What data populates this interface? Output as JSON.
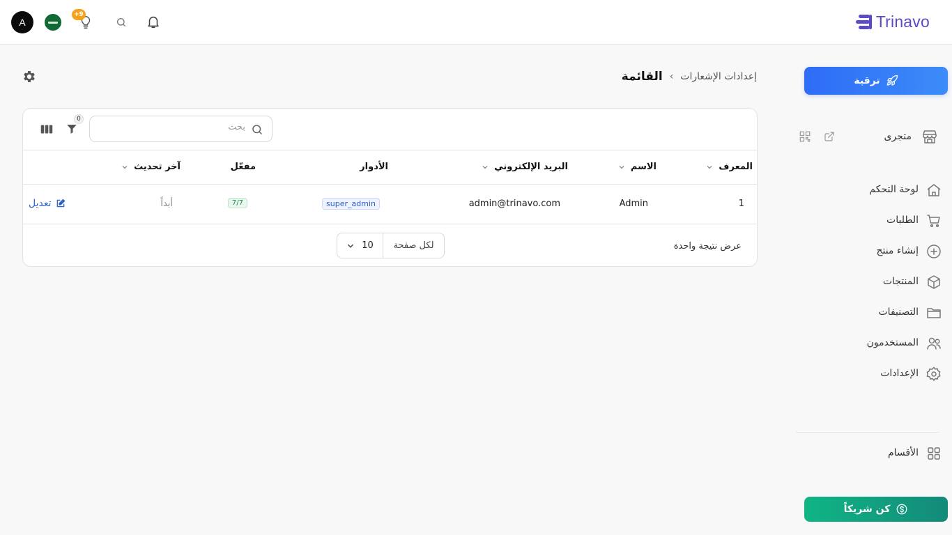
{
  "header": {
    "logo_text": "Trinavo",
    "avatar_initial": "A",
    "notification_badge": "+9",
    "brand_color": "#5b4cc4"
  },
  "sidebar": {
    "upgrade_label": "ترقية",
    "store_label": "متجرى",
    "items": [
      {
        "label": "لوحة التحكم",
        "icon": "home-icon"
      },
      {
        "label": "الطلبات",
        "icon": "cart-icon"
      },
      {
        "label": "إنشاء منتج",
        "icon": "plus-circle-icon"
      },
      {
        "label": "المنتجات",
        "icon": "box-icon"
      },
      {
        "label": "التصنيفات",
        "icon": "folder-icon"
      },
      {
        "label": "المستخدمون",
        "icon": "users-icon"
      },
      {
        "label": "الإعدادات",
        "icon": "gear-icon"
      }
    ],
    "sections_label": "الأقسام",
    "partner_label": "كن شريكاً"
  },
  "breadcrumb": {
    "parent": "إعدادات الإشعارات",
    "current": "القائمة"
  },
  "toolbar": {
    "search_placeholder": "بحث",
    "filter_count": "0"
  },
  "table": {
    "columns": {
      "id": "المعرف",
      "name": "الاسم",
      "email": "البريد الإلكتروني",
      "roles": "الأدوار",
      "active": "مفعّل",
      "updated": "آخر تحديث"
    },
    "rows": [
      {
        "id": "1",
        "name": "Admin",
        "email": "admin@trinavo.com",
        "role": "super_admin",
        "active": "7/7",
        "updated": "أبداً",
        "edit_label": "تعديل"
      }
    ]
  },
  "footer": {
    "results_text": "عرض نتيجة واحدة",
    "per_page_label": "لكل صفحة",
    "per_page_value": "10"
  }
}
